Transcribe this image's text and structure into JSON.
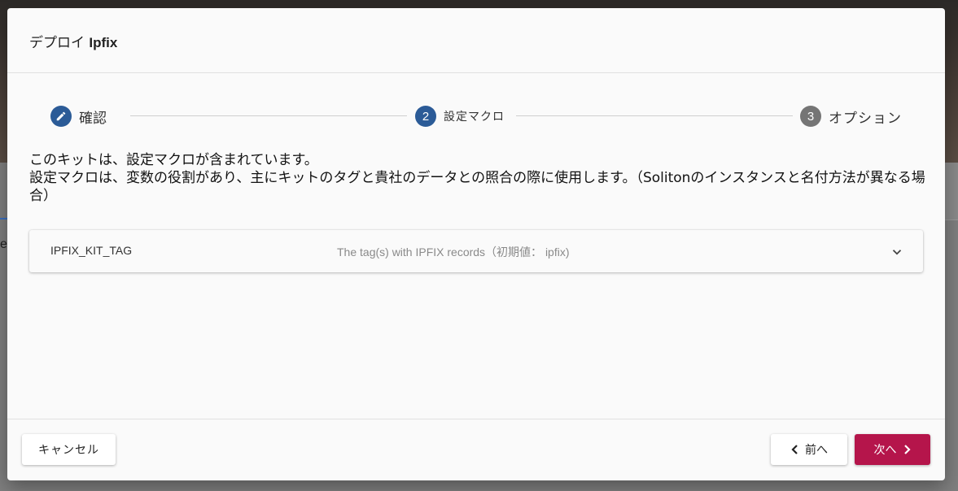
{
  "background": {
    "partial_text": "e"
  },
  "dialog": {
    "title_prefix": "デプロイ",
    "title_app": "Ipfix"
  },
  "stepper": {
    "steps": [
      {
        "label": "確認",
        "number": "",
        "state": "done",
        "icon": "pencil-icon"
      },
      {
        "label": "設定マクロ",
        "number": "2",
        "state": "active"
      },
      {
        "label": "オプション",
        "number": "3",
        "state": "pending"
      }
    ]
  },
  "description": {
    "line1": "このキットは、設定マクロが含まれています。",
    "line2": "設定マクロは、変数の役割があり、主にキットのタグと貴社のデータとの照合の際に使用します。（Solitonのインスタンスと名付方法が異なる場合）"
  },
  "macros": [
    {
      "name": "IPFIX_KIT_TAG",
      "description": "The tag(s) with IPFIX records（初期値： ipfix)",
      "expand_icon": "chevron-down-icon"
    }
  ],
  "footer": {
    "cancel_label": "キャンセル",
    "prev_label": "前へ",
    "next_label": "次へ"
  },
  "colors": {
    "step_active": "#2b5b97",
    "step_pending": "#757575",
    "next_button": "#b5154b"
  }
}
